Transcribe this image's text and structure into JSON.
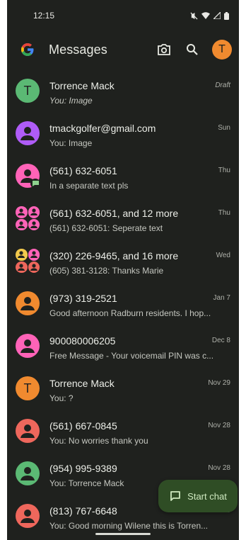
{
  "status": {
    "time": "12:15"
  },
  "appbar": {
    "title": "Messages",
    "profile_initial": "T"
  },
  "conversations": [
    {
      "name": "Torrence Mack",
      "preview": "You: Image",
      "time": "Draft",
      "avatar_letter": "T",
      "avatar_color": "#5bb974"
    },
    {
      "name": "tmackgolfer@gmail.com",
      "preview": "You: Image",
      "time": "Sun",
      "avatar_color": "#af5cf7"
    },
    {
      "name": "(561) 632-6051",
      "preview": "In a separate text pls",
      "time": "Thu",
      "avatar_color": "#ff63b8"
    },
    {
      "name": "(561) 632-6051, and 12 more",
      "preview": "(561) 632-6051: Seperate text",
      "time": "Thu",
      "avatar_color": "#ff63b8"
    },
    {
      "name": "(320) 226-9465, and 16 more",
      "preview": "(605) 381-3128: Thanks Marie",
      "time": "Wed",
      "avatar_color": "#f2c94c"
    },
    {
      "name": "(973) 319-2521",
      "preview": "Good afternoon Radburn residents. I hop...",
      "time": "Jan 7",
      "avatar_color": "#f08a2f"
    },
    {
      "name": "900080006205",
      "preview": "Free Message - Your voicemail PIN was c...",
      "time": "Dec 8",
      "avatar_color": "#ff63b8"
    },
    {
      "name": "Torrence Mack",
      "preview": "You: ?",
      "time": "Nov 29",
      "avatar_letter": "T",
      "avatar_color": "#f08a2f"
    },
    {
      "name": "(561) 667-0845",
      "preview": "You: No worries thank you",
      "time": "Nov 28",
      "avatar_color": "#ee675c"
    },
    {
      "name": "(954) 995-9389",
      "preview": "You: Torrence Mack",
      "time": "Nov 28",
      "avatar_color": "#5bb974"
    },
    {
      "name": "(813) 767-6648",
      "preview": "You: Good morning Wilene this is Torren...",
      "time": "Nov 28",
      "avatar_color": "#ee675c"
    }
  ],
  "fab": {
    "label": "Start chat"
  },
  "colors": {
    "background": "#1f211e",
    "fab": "#2f4d25",
    "fab_text": "#cfe9c0"
  }
}
